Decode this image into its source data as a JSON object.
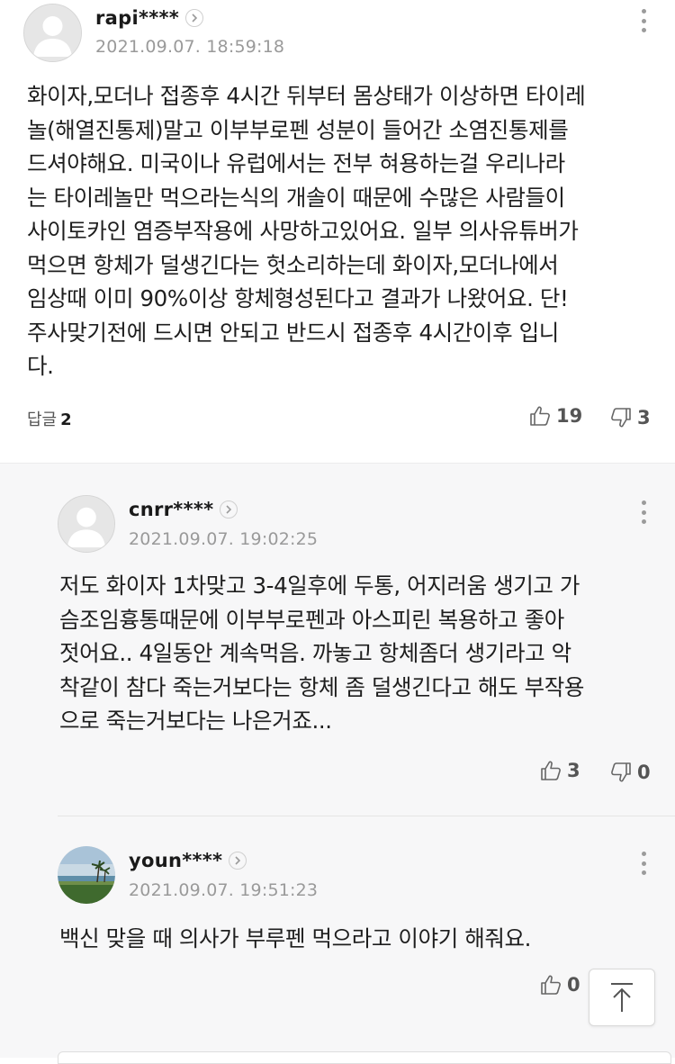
{
  "comments": [
    {
      "username": "rapi****",
      "date": "2021.09.07. 18:59:18",
      "avatar": "default-avatar",
      "text": "화이자,모더나 접종후 4시간 뒤부터 몸상태가 이상하면 타이레\n놀(해열진통제)말고 이부부로펜 성분이 들어간 소염진통제를\n드셔야해요. 미국이나 유럽에서는 전부 혀용하는걸 우리나라\n는 타이레놀만 먹으라는식의 개솔이 때문에 수많은 사람들이\n사이토카인 염증부작용에 사망하고있어요. 일부 의사유튜버가\n먹으면 항체가 덜생긴다는 헛소리하는데 화이자,모더나에서\n임상때 이미 90%이상 항체형성된다고 결과가 나왔어요. 단!\n주사맞기전에 드시면 안되고 반드시 접종후 4시간이후 입니\n다.",
      "reply_label": "답글",
      "reply_count": "2",
      "likes": "19",
      "dislikes": "3"
    }
  ],
  "replies": [
    {
      "username": "cnrr****",
      "date": "2021.09.07. 19:02:25",
      "avatar": "default-avatar",
      "text": "저도 화이자 1차맞고 3-4일후에 두통, 어지러움 생기고 가\n슴조임흉통때문에 이부부로펜과 아스피린 복용하고 좋아\n젓어요.. 4일동안 계속먹음. 까놓고 항체좀더 생기라고 악\n착같이 참다 죽는거보다는 항체 좀 덜생긴다고 해도 부작용\n으로 죽는거보다는 나은거죠...",
      "likes": "3",
      "dislikes": "0"
    },
    {
      "username": "youn****",
      "date": "2021.09.07. 19:51:23",
      "avatar": "beach-palm-photo",
      "text": "백신 맞을 때 의사가 부루펜 먹으라고 이야기 해줘요.",
      "likes": "0"
    }
  ],
  "icons": {
    "like": "thumbs-up-icon",
    "dislike": "thumbs-down-icon",
    "more": "more-vertical-icon",
    "profile": "chevron-right-icon",
    "scroll_top": "arrow-up-icon"
  },
  "colors": {
    "reply_section_bg": "#f7f7f8",
    "meta_text": "#9a9a9a"
  }
}
